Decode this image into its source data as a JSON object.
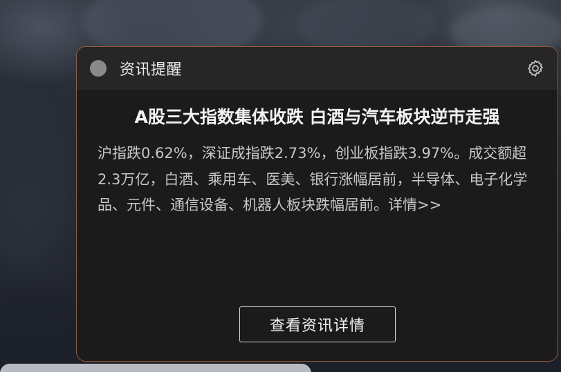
{
  "notification": {
    "title": "资讯提醒",
    "headline": "A股三大指数集体收跌 白酒与汽车板块逆市走强",
    "summary": "沪指跌0.62%，深证成指跌2.73%，创业板指跌3.97%。成交额超2.3万亿，白酒、乘用车、医美、银行涨幅居前，半导体、电子化学品、元件、通信设备、机器人板块跌幅居前。",
    "detail_link": "详情>>",
    "button_label": "查看资讯详情",
    "icons": {
      "status": "status-dot-icon",
      "settings": "gear-icon"
    },
    "colors": {
      "panel_background": "#1b1b1b",
      "header_background": "#262626",
      "border_accent": "#9a5a36",
      "status_dot": "#8a8a8a"
    }
  }
}
